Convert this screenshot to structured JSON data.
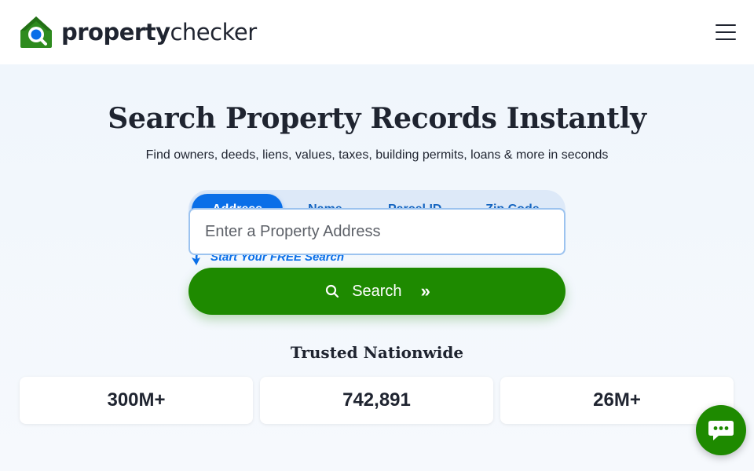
{
  "header": {
    "logo_text_bold": "property",
    "logo_text_regular": "checker",
    "logo_icon": "house-magnifier-icon",
    "menu_icon": "hamburger-menu-icon"
  },
  "hero": {
    "title_bold": "Search Property Records",
    "title_regular": "Instantly",
    "subtitle": "Find owners, deeds, liens, values, taxes, building permits, loans & more in seconds"
  },
  "tabs": [
    {
      "label": "Address",
      "active": true
    },
    {
      "label": "Name",
      "active": false
    },
    {
      "label": "Parcel ID",
      "active": false
    },
    {
      "label": "Zip Code",
      "active": false
    }
  ],
  "search": {
    "cta": "Start Your FREE Search",
    "placeholder": "Enter a Property Address",
    "value": "",
    "button_label": "Search",
    "button_chevron": "»"
  },
  "trusted": {
    "heading": "Trusted Nationwide",
    "stats": [
      "300M+",
      "742,891",
      "26M+"
    ]
  },
  "chat": {
    "icon": "chat-bubble-icon"
  },
  "colors": {
    "brand_green": "#1e8a00",
    "brand_blue": "#0a6fe8",
    "tab_track": "#dde9f8",
    "hero_bg": "#f0f6fc"
  }
}
